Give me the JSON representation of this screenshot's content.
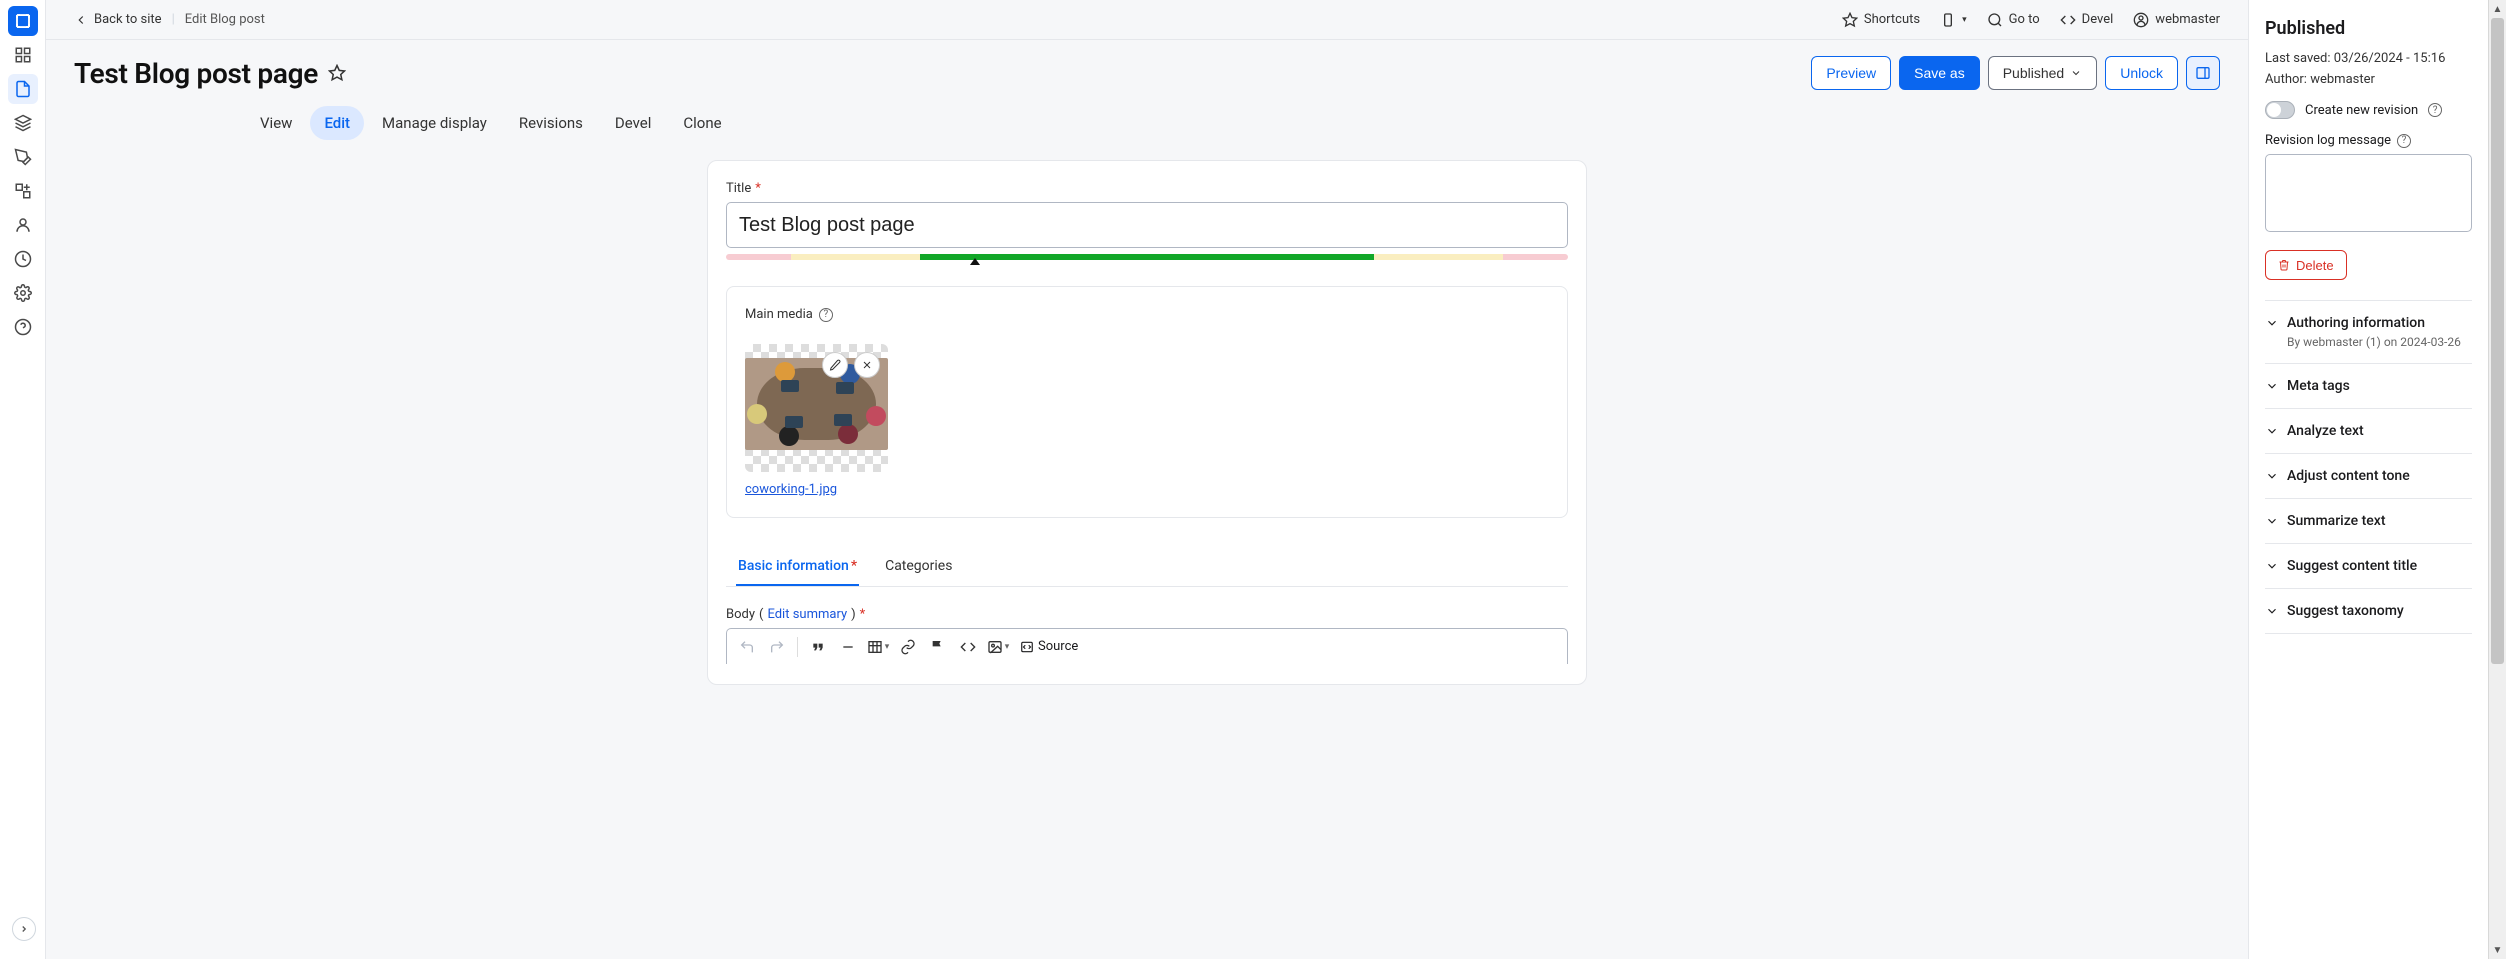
{
  "topbar": {
    "back_label": "Back to site",
    "crumb": "Edit Blog post",
    "shortcuts": "Shortcuts",
    "goto": "Go to",
    "devel": "Devel",
    "user": "webmaster"
  },
  "page": {
    "title": "Test Blog post page"
  },
  "actions": {
    "preview": "Preview",
    "save_as": "Save as",
    "status": "Published",
    "unlock": "Unlock"
  },
  "tabs": {
    "view": "View",
    "edit": "Edit",
    "manage_display": "Manage display",
    "revisions": "Revisions",
    "devel": "Devel",
    "clone": "Clone"
  },
  "form": {
    "title_label": "Title",
    "title_value": "Test Blog post page",
    "media_label": "Main media",
    "media_filename": "coworking-1.jpg",
    "sub_basic": "Basic information",
    "sub_categories": "Categories",
    "body_label": "Body",
    "edit_summary": "Edit summary",
    "source_label": "Source"
  },
  "sidebar": {
    "status_heading": "Published",
    "last_saved_label": "Last saved:",
    "last_saved_value": "03/26/2024 - 15:16",
    "author_label": "Author:",
    "author_value": "webmaster",
    "create_revision": "Create new revision",
    "revision_log_label": "Revision log message",
    "delete": "Delete",
    "accordions": [
      {
        "name": "authoring-information",
        "title": "Authoring information",
        "sub": "By webmaster (1) on 2024-03-26"
      },
      {
        "name": "meta-tags",
        "title": "Meta tags"
      },
      {
        "name": "analyze-text",
        "title": "Analyze text"
      },
      {
        "name": "adjust-content-tone",
        "title": "Adjust content tone"
      },
      {
        "name": "summarize-text",
        "title": "Summarize text"
      },
      {
        "name": "suggest-content-title",
        "title": "Suggest content title"
      },
      {
        "name": "suggest-taxonomy",
        "title": "Suggest taxonomy"
      }
    ]
  }
}
